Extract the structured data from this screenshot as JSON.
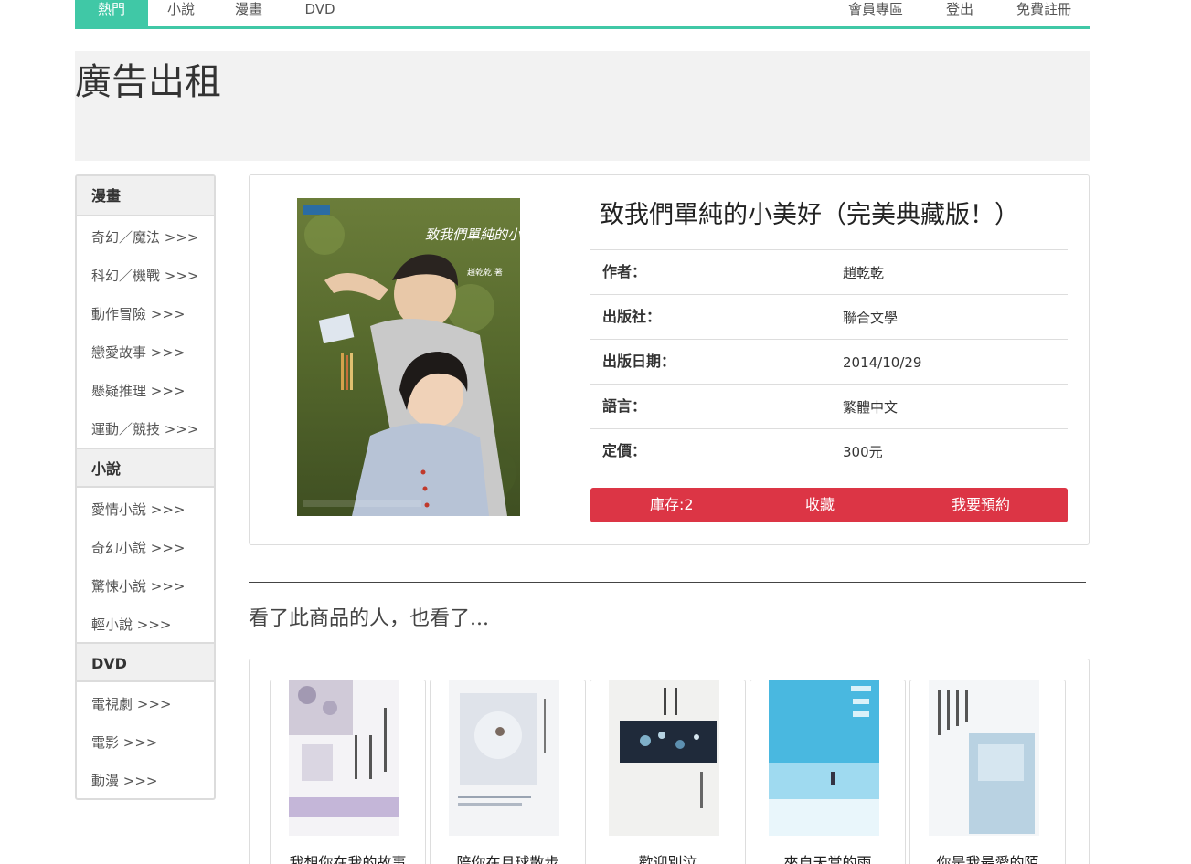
{
  "nav": {
    "tabs": [
      "熱門",
      "小說",
      "漫畫",
      "DVD"
    ],
    "right": [
      "會員專區",
      "登出",
      "免費註冊"
    ]
  },
  "ad": {
    "text": "廣告出租"
  },
  "sidebar": {
    "sections": [
      {
        "heading": "漫畫",
        "items": [
          "奇幻／魔法 >>>",
          "科幻／機戰 >>>",
          "動作冒險 >>>",
          "戀愛故事 >>>",
          "懸疑推理 >>>",
          "運動／競技 >>>"
        ]
      },
      {
        "heading": "小說",
        "items": [
          "愛情小說 >>>",
          "奇幻小說 >>>",
          "驚悚小說 >>>",
          "輕小說 >>>"
        ]
      },
      {
        "heading": "DVD",
        "items": [
          "電視劇 >>>",
          "電影 >>>",
          "動漫 >>>"
        ]
      }
    ]
  },
  "product": {
    "title": "致我們單純的小美好（完美典藏版！）",
    "cover_text": "致我們單純的小美好",
    "cover_author": "趙乾乾 著",
    "fields": [
      {
        "label": "作者：",
        "value": "趙乾乾"
      },
      {
        "label": "出版社：",
        "value": "聯合文學"
      },
      {
        "label": "出版日期：",
        "value": "2014/10/29"
      },
      {
        "label": "語言：",
        "value": "繁體中文"
      },
      {
        "label": "定價：",
        "value": "300元"
      }
    ],
    "actions": {
      "stock": "庫存:2",
      "favorite": "收藏",
      "reserve": "我要預約"
    }
  },
  "divider": "",
  "recommend": {
    "heading": "看了此商品的人，也看了...",
    "items": [
      {
        "title": "我想你在我的故事"
      },
      {
        "title": "陪你在月球散步"
      },
      {
        "title": "歡迎別泣"
      },
      {
        "title": "來自天堂的雨"
      },
      {
        "title": "你是我最愛的陌"
      }
    ]
  },
  "colors": {
    "accent": "#40c8a6",
    "action": "#dc3545"
  }
}
